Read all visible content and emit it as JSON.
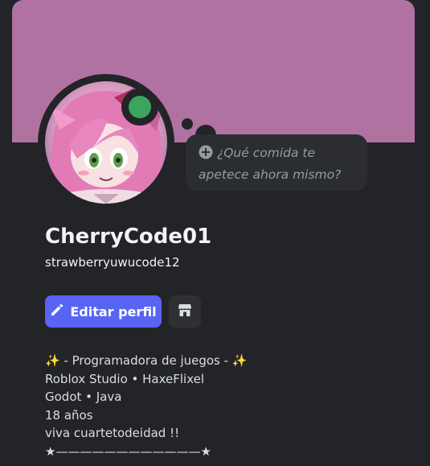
{
  "profile": {
    "display_name": "CherryCode01",
    "username": "strawberryuwucode12",
    "status_prompt_line1": "¿Qué comida te",
    "status_prompt_line2": "apetece ahora mismo?",
    "online_status": "online",
    "banner_color": "#b072a1",
    "status_color": "#3ba55d"
  },
  "actions": {
    "edit_label": "Editar perfil",
    "edit_icon": "pencil-icon",
    "shop_icon": "shop-icon",
    "accent": "#5865f2"
  },
  "bio": {
    "line1_text": " - Programadora de juegos  - ",
    "line1_emoji": "✨",
    "lines": [
      "Roblox Studio • HaxeFlixel",
      " Godot • Java",
      "18 años",
      "viva cuartetodeidad !!",
      "★————————————★"
    ]
  }
}
